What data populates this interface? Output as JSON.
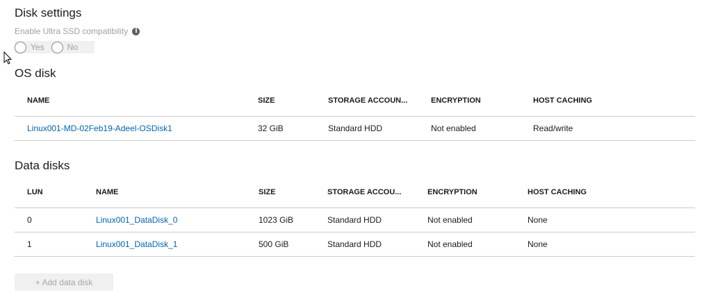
{
  "disk_settings": {
    "title": "Disk settings",
    "ultra_ssd_label": "Enable Ultra SSD compatibility",
    "info_icon": "info-icon",
    "options": [
      "Yes",
      "No"
    ]
  },
  "os_disk": {
    "title": "OS disk",
    "headers": [
      "NAME",
      "SIZE",
      "STORAGE ACCOUN...",
      "ENCRYPTION",
      "HOST CACHING"
    ],
    "rows": [
      {
        "name": "Linux001-MD-02Feb19-Adeel-OSDisk1",
        "size": "32 GiB",
        "storage": "Standard HDD",
        "encryption": "Not enabled",
        "host_caching": "Read/write"
      }
    ]
  },
  "data_disks": {
    "title": "Data disks",
    "headers": [
      "LUN",
      "NAME",
      "SIZE",
      "STORAGE ACCOU...",
      "ENCRYPTION",
      "HOST CACHING"
    ],
    "rows": [
      {
        "lun": "0",
        "name": "Linux001_DataDisk_0",
        "size": "1023 GiB",
        "storage": "Standard HDD",
        "encryption": "Not enabled",
        "host_caching": "None"
      },
      {
        "lun": "1",
        "name": "Linux001_DataDisk_1",
        "size": "500 GiB",
        "storage": "Standard HDD",
        "encryption": "Not enabled",
        "host_caching": "None"
      }
    ],
    "add_button": "+ Add data disk"
  },
  "colors": {
    "link": "#0063b1",
    "disabled_text": "#a0a0a0",
    "divider": "#cccccc"
  }
}
